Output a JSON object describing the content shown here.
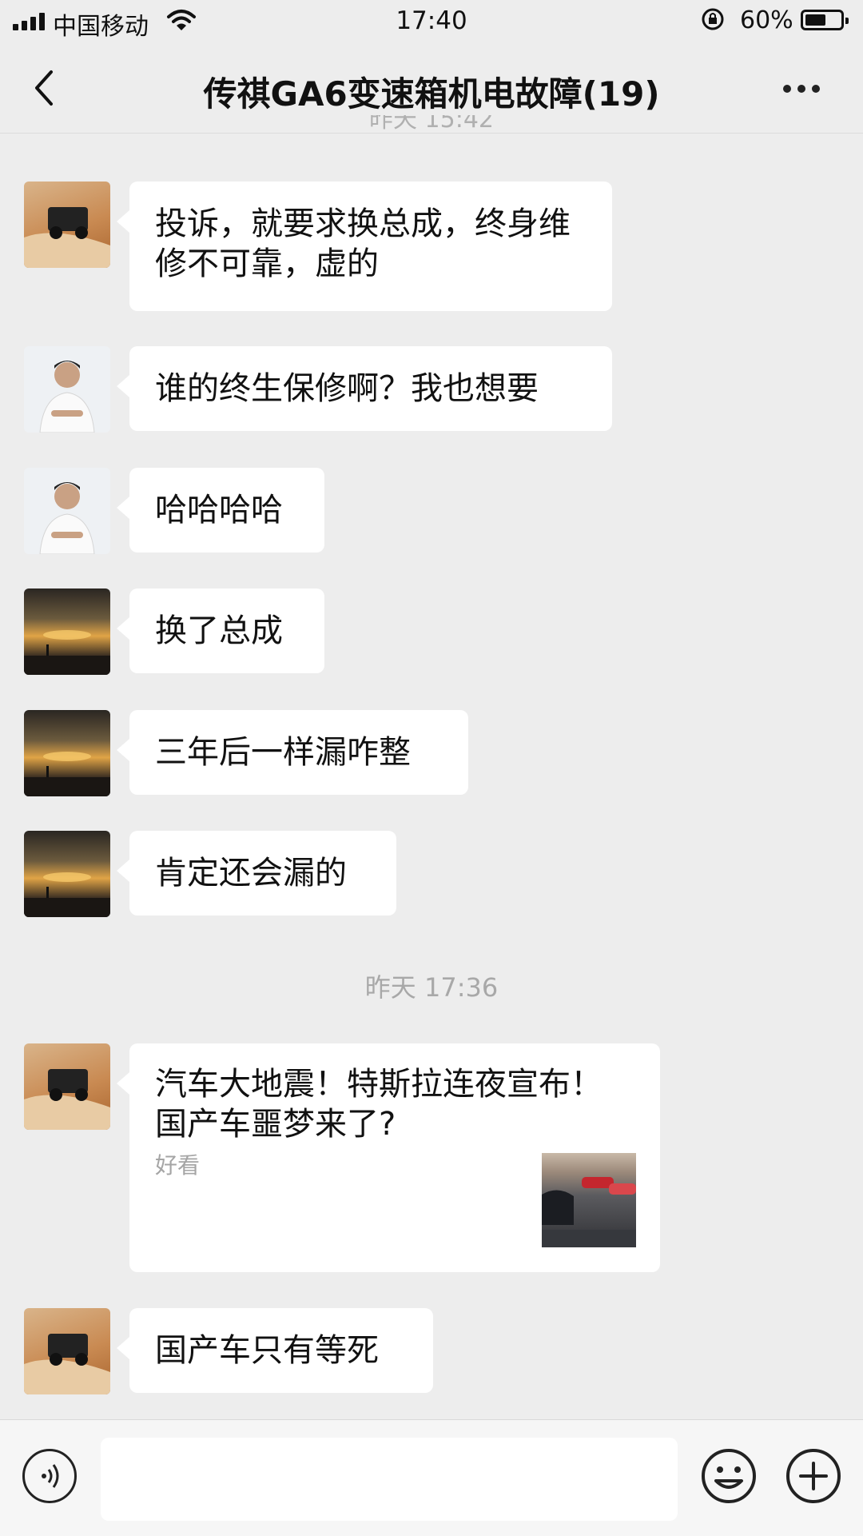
{
  "status_bar": {
    "carrier": "中国移动",
    "time": "17:40",
    "battery_percent": "60%",
    "battery_level": 0.6
  },
  "header": {
    "title": "传祺GA6变速箱机电故障(19)"
  },
  "messages": [
    {
      "avatar": "desert-jeep-avatar",
      "text": "投诉，就要求换总成，终身维修不可靠，虚的"
    },
    {
      "avatar": "man-white-shirt-avatar",
      "text": "谁的终生保修啊？我也想要"
    },
    {
      "avatar": "man-white-shirt-avatar",
      "text": "哈哈哈哈"
    },
    {
      "avatar": "sunset-lake-avatar",
      "text": "换了总成"
    },
    {
      "avatar": "sunset-lake-avatar",
      "text": "三年后一样漏咋整"
    },
    {
      "avatar": "sunset-lake-avatar",
      "text": "肯定还会漏的"
    }
  ],
  "timestamp": "昨天 17:36",
  "link_message": {
    "avatar": "desert-jeep-avatar",
    "title": "汽车大地震！特斯拉连夜宣布！国产车噩梦来了?",
    "source": "好看",
    "thumbnail": "tesla-cars-thumbnail"
  },
  "last_message": {
    "avatar": "desert-jeep-avatar",
    "text": "国产车只有等死"
  },
  "input_bar": {
    "voice_icon": "voice-icon",
    "emoji_icon": "emoji-icon",
    "plus_icon": "plus-icon"
  },
  "colors": {
    "background": "#ededed",
    "bubble": "#ffffff",
    "timestamp_text": "#a8a8a8"
  }
}
